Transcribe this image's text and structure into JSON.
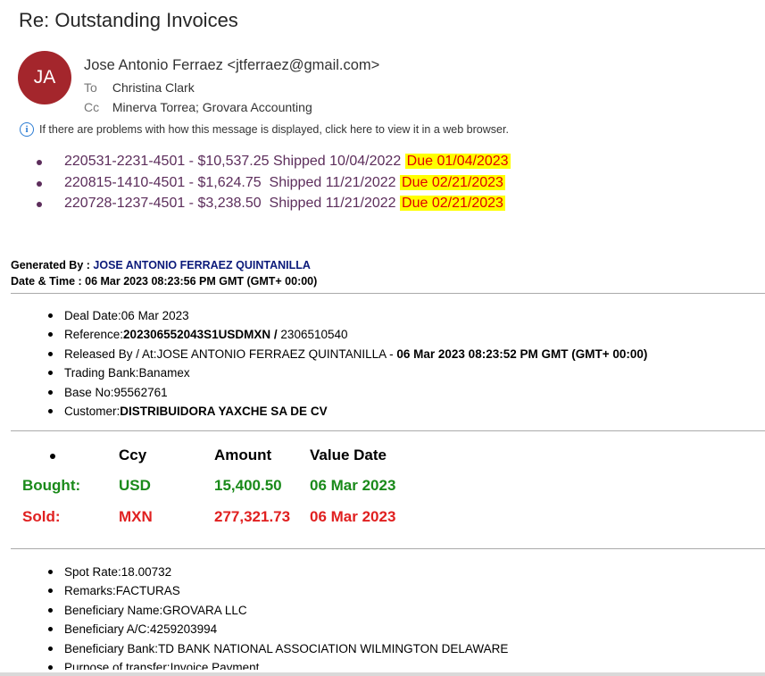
{
  "subject": "Re: Outstanding Invoices",
  "sender": {
    "initials": "JA",
    "from": "Jose Antonio Ferraez <jtferraez@gmail.com>",
    "to_label": "To",
    "to": "Christina Clark",
    "cc_label": "Cc",
    "cc": "Minerva Torrea; Grovara Accounting",
    "avatar_color": "#a4262c"
  },
  "info_bar": "If there are problems with how this message is displayed, click here to view it in a web browser.",
  "invoices": [
    {
      "text": "220531-2231-4501 - $10,537.25 Shipped 10/04/2022",
      "due": "Due 01/04/2023"
    },
    {
      "text": "220815-1410-4501 - $1,624.75  Shipped 11/21/2022",
      "due": "Due 02/21/2023"
    },
    {
      "text": "220728-1237-4501 - $3,238.50  Shipped 11/21/2022",
      "due": "Due 02/21/2023"
    }
  ],
  "generated": {
    "by_label": "Generated By : ",
    "by_value": "JOSE ANTONIO FERRAEZ QUINTANILLA",
    "dt_label": "Date & Time : ",
    "dt_value": "06 Mar 2023 08:23:56 PM GMT (GMT+ 00:00)"
  },
  "details": {
    "deal_date_label": "Deal Date:",
    "deal_date": "06 Mar 2023",
    "reference_label": "Reference:",
    "reference_bold": "202306552043S1USDMXN / ",
    "reference_rest": "2306510540",
    "released_label": "Released By / At:",
    "released_name": "JOSE ANTONIO FERRAEZ QUINTANILLA - ",
    "released_time": "06 Mar 2023 08:23:52 PM GMT (GMT+ 00:00)",
    "trading_bank_label": "Trading Bank:",
    "trading_bank": "Banamex",
    "base_no_label": "Base No:",
    "base_no": "95562761",
    "customer_label": "Customer:",
    "customer": "DISTRIBUIDORA YAXCHE SA DE CV"
  },
  "fx_table": {
    "headers": {
      "ccy": "Ccy",
      "amount": "Amount",
      "value_date": "Value Date"
    },
    "bought": {
      "label": "Bought:",
      "ccy": "USD",
      "amount": "15,400.50",
      "value_date": "06 Mar 2023"
    },
    "sold": {
      "label": "Sold:",
      "ccy": "MXN",
      "amount": "277,321.73",
      "value_date": "06 Mar 2023"
    },
    "bought_color": "#1a8a1a",
    "sold_color": "#e02020"
  },
  "extra": {
    "spot_rate_label": "Spot Rate:",
    "spot_rate": "18.00732",
    "remarks_label": "Remarks:",
    "remarks": "FACTURAS",
    "ben_name_label": "Beneficiary Name:",
    "ben_name": "GROVARA LLC",
    "ben_ac_label": "Beneficiary A/C:",
    "ben_ac": "4259203994",
    "ben_bank_label": "Beneficiary Bank:",
    "ben_bank": "TD BANK NATIONAL ASSOCIATION WILMINGTON DELAWARE",
    "purpose_label": "Purpose of transfer:",
    "purpose": "Invoice Payment"
  }
}
